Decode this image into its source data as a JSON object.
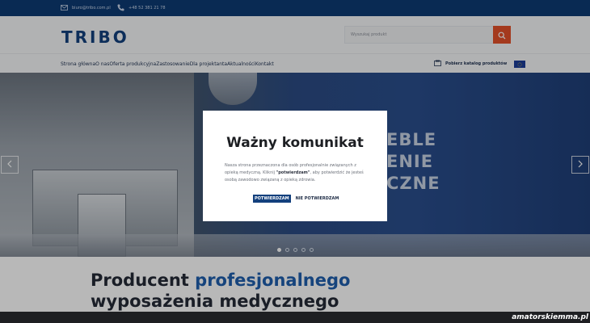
{
  "topbar": {
    "email": "biuro@tribo.com.pl",
    "phone": "+48 52 381 21 78",
    "icons": [
      "mail-icon",
      "phone-icon"
    ]
  },
  "header": {
    "logo": "TRIBO",
    "search": {
      "placeholder": "Wyszukaj produkt"
    }
  },
  "nav": {
    "items": [
      "Strona główna",
      "O nas",
      "Oferta produkcyjna",
      "Zastosowanie",
      "Dla projektanta",
      "Aktualności",
      "Kontakt"
    ],
    "catalog_label": "Pobierz katalog produktów"
  },
  "hero": {
    "text_lines": [
      "EBLE",
      "ENIE",
      "CZNE"
    ],
    "slides_total": 5,
    "active_slide": 1
  },
  "modal": {
    "title": "Ważny komunikat",
    "body_before": "Nasza strona przeznaczona dla osób profesjonalnie związanych z opieką medyczną. Kliknij ",
    "body_highlight": "\"potwierdzam\"",
    "body_after": ", aby potwierdzić że jesteś osobą zawodowo związaną z opieką zdrowia.",
    "confirm_label": "POTWIERDZAM",
    "deny_label": "NIE POTWIERDZAM"
  },
  "section": {
    "title_prefix": "Producent ",
    "title_accent": "profesjonalnego",
    "title_suffix": " wyposażenia medycznego"
  },
  "watermark": "amatorskiemma.pl",
  "colors": {
    "brand": "#13407d",
    "accent": "#e4512a",
    "topbar": "#0d3b73"
  }
}
